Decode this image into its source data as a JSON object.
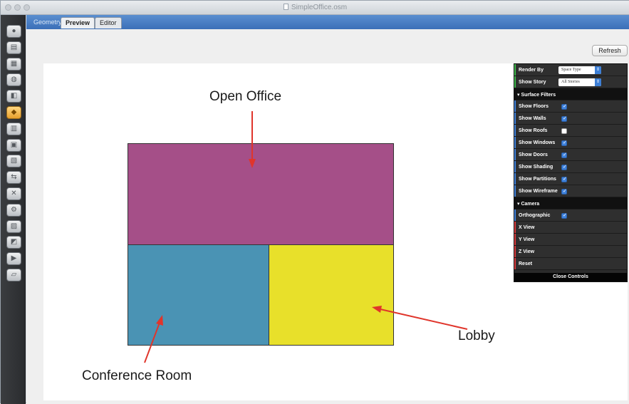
{
  "window": {
    "title": "SimpleOffice.osm"
  },
  "tabs": [
    {
      "label": "Geometry",
      "state": "inactive"
    },
    {
      "label": "Preview",
      "state": "active"
    },
    {
      "label": "Editor",
      "state": "inactive"
    }
  ],
  "toolbar": {
    "refresh_label": "Refresh",
    "tools": [
      {
        "icon": "site-icon",
        "glyph": "●",
        "active": false
      },
      {
        "icon": "schedules-icon",
        "glyph": "▤",
        "active": false
      },
      {
        "icon": "constructions-icon",
        "glyph": "▦",
        "active": false
      },
      {
        "icon": "loads-icon",
        "glyph": "◍",
        "active": false
      },
      {
        "icon": "space-types-icon",
        "glyph": "◧",
        "active": false
      },
      {
        "icon": "geometry-icon",
        "glyph": "◆",
        "active": true
      },
      {
        "icon": "facility-icon",
        "glyph": "▥",
        "active": false
      },
      {
        "icon": "spaces-icon",
        "glyph": "▣",
        "active": false
      },
      {
        "icon": "thermal-zones-icon",
        "glyph": "▧",
        "active": false
      },
      {
        "icon": "hvac-systems-icon",
        "glyph": "⇆",
        "active": false
      },
      {
        "icon": "building-summary-icon",
        "glyph": "✕",
        "active": false
      },
      {
        "icon": "output-variables-icon",
        "glyph": "⚙",
        "active": false
      },
      {
        "icon": "simulation-settings-icon",
        "glyph": "▨",
        "active": false
      },
      {
        "icon": "measures-icon",
        "glyph": "◩",
        "active": false
      },
      {
        "icon": "run-simulation-icon",
        "glyph": "▶",
        "active": false
      },
      {
        "icon": "results-summary-icon",
        "glyph": "▱",
        "active": false
      }
    ]
  },
  "viewport": {
    "spaces": [
      {
        "name": "Open Office",
        "color": "#a54f88"
      },
      {
        "name": "Conference Room",
        "color": "#4a93b4"
      },
      {
        "name": "Lobby",
        "color": "#e8e02a"
      }
    ],
    "annotations": {
      "open_office": "Open Office",
      "conference_room": "Conference Room",
      "lobby": "Lobby"
    },
    "arrow_color": "#e0352b"
  },
  "controls": {
    "render_by_label": "Render By",
    "render_by_value": "Space Type",
    "show_story_label": "Show Story",
    "show_story_value": "All Stories",
    "surface_filters_label": "Surface Filters",
    "surface_filters": [
      {
        "label": "Show Floors",
        "checked": true
      },
      {
        "label": "Show Walls",
        "checked": true
      },
      {
        "label": "Show Roofs",
        "checked": false
      },
      {
        "label": "Show Windows",
        "checked": true
      },
      {
        "label": "Show Doors",
        "checked": true
      },
      {
        "label": "Show Shading",
        "checked": true
      },
      {
        "label": "Show Partitions",
        "checked": true
      },
      {
        "label": "Show Wireframe",
        "checked": true
      }
    ],
    "camera_label": "Camera",
    "orthographic_label": "Orthographic",
    "orthographic_checked": true,
    "views": [
      "X View",
      "Y View",
      "Z View",
      "Reset"
    ],
    "close_label": "Close Controls",
    "accent_colors": {
      "green": "#3bb84a",
      "red": "#d9393b",
      "blue": "#3f82dc"
    }
  }
}
